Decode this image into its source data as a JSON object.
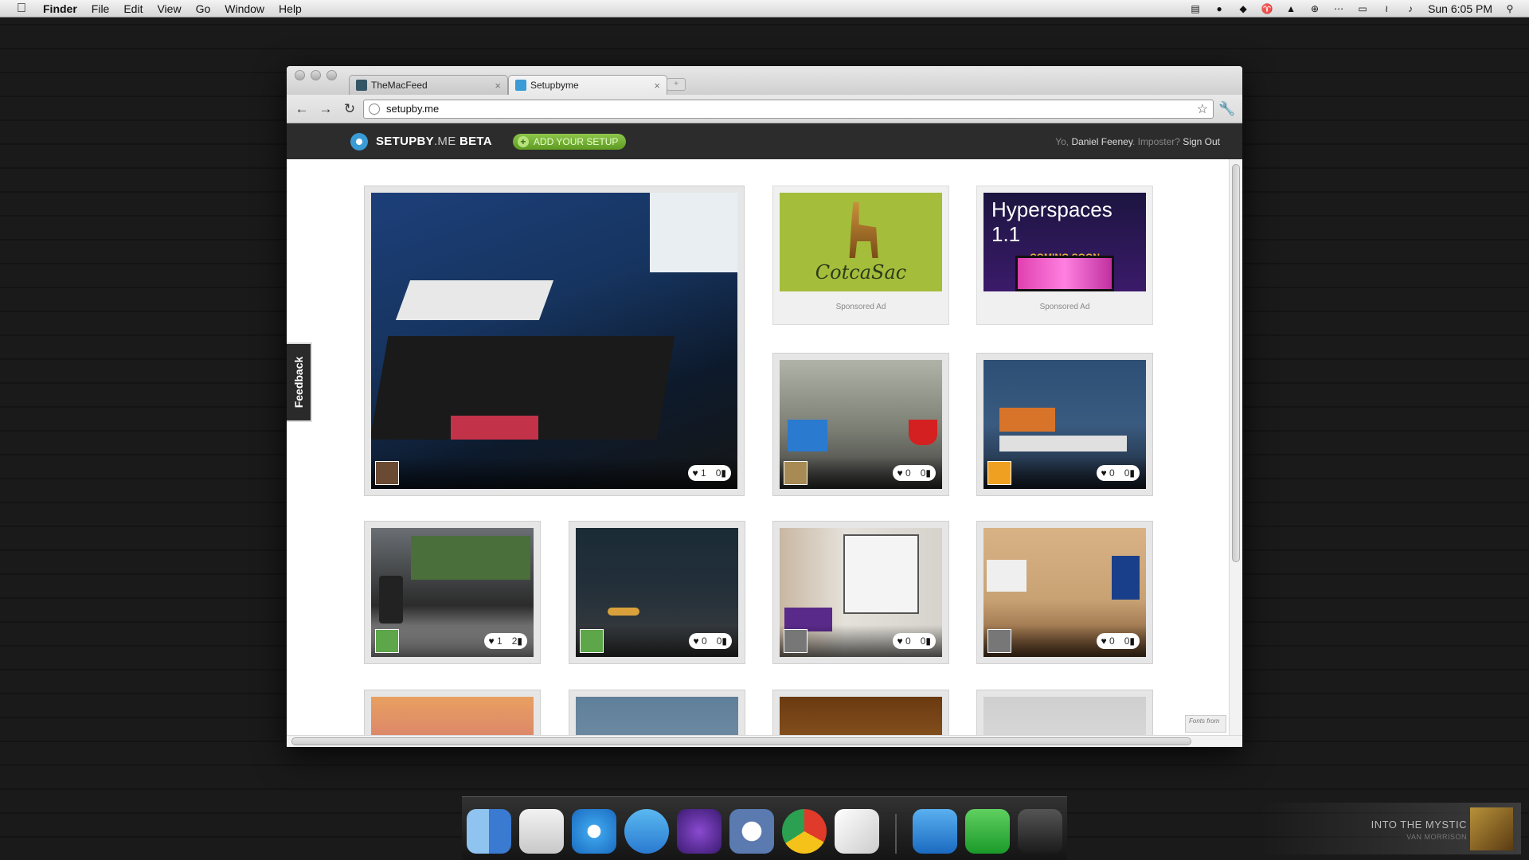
{
  "menubar": {
    "app": "Finder",
    "items": [
      "File",
      "Edit",
      "View",
      "Go",
      "Window",
      "Help"
    ],
    "clock": "Sun 6:05 PM"
  },
  "browser": {
    "tabs": [
      {
        "title": "TheMacFeed",
        "active": false
      },
      {
        "title": "Setupbyme",
        "active": true
      }
    ],
    "url": "setupby.me"
  },
  "site": {
    "brand_main": "SETUPBY",
    "brand_dot": ".ME",
    "brand_beta": " BETA",
    "add_button": "ADD YOUR SETUP",
    "greeting": "Yo, ",
    "username": "Daniel Feeney",
    "imposter": ". Imposter? ",
    "signout": "Sign Out",
    "feedback": "Feedback",
    "sponsored_label": "Sponsored Ad",
    "ad1_text": "CotcaSac",
    "ad2_title": "Hyperspaces 1.1",
    "ad2_sub": "COMING SOON",
    "fonts_badge": "Fonts from"
  },
  "setups": [
    {
      "likes": "1",
      "comments": "0"
    },
    {
      "likes": "0",
      "comments": "0"
    },
    {
      "likes": "0",
      "comments": "0"
    },
    {
      "likes": "1",
      "comments": "2"
    },
    {
      "likes": "0",
      "comments": "0"
    },
    {
      "likes": "0",
      "comments": "0"
    },
    {
      "likes": "0",
      "comments": "0"
    }
  ],
  "nowplaying": {
    "title": "INTO THE MYSTIC",
    "artist": "VAN MORRISON"
  },
  "colors": {
    "header_bg": "#2c2c2c",
    "accent_green": "#6fae2c",
    "logo_blue": "#3a9bd5"
  }
}
